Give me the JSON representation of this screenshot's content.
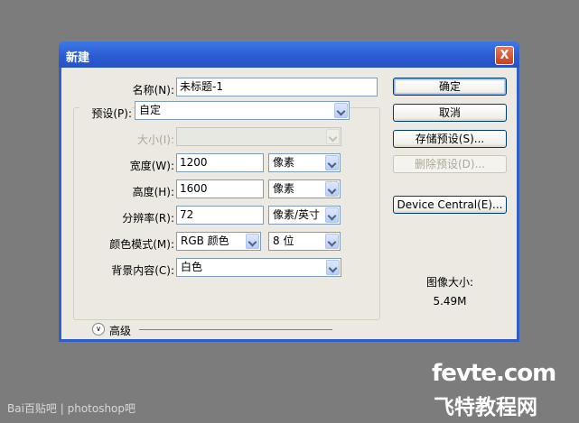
{
  "window": {
    "title": "新建",
    "close_label": "X"
  },
  "form": {
    "name": {
      "label": "名称(N):",
      "value": "未标题-1"
    },
    "preset": {
      "label": "预设(P):",
      "value": "自定"
    },
    "size": {
      "label": "大小(I):",
      "value": ""
    },
    "width": {
      "label": "宽度(W):",
      "value": "1200",
      "unit": "像素"
    },
    "height": {
      "label": "高度(H):",
      "value": "1600",
      "unit": "像素"
    },
    "resolution": {
      "label": "分辨率(R):",
      "value": "72",
      "unit": "像素/英寸"
    },
    "color_mode": {
      "label": "颜色模式(M):",
      "value": "RGB 颜色",
      "depth": "8 位"
    },
    "background": {
      "label": "背景内容(C):",
      "value": "白色"
    },
    "advanced": {
      "label": "高级"
    }
  },
  "buttons": {
    "ok": "确定",
    "cancel": "取消",
    "save_preset": "存储预设(S)...",
    "delete_preset": "删除预设(D)...",
    "device_central": "Device Central(E)..."
  },
  "image_size": {
    "label": "图像大小:",
    "value": "5.49M"
  },
  "watermarks": {
    "baidu": "Bai百贴吧 | photoshop吧",
    "site": "fevte.com",
    "site_cn": "飞特教程网"
  },
  "colors": {
    "title_bar": "#2a5cd2",
    "dialog_bg": "#ebe9e2",
    "desktop": "#7c7c7c"
  }
}
